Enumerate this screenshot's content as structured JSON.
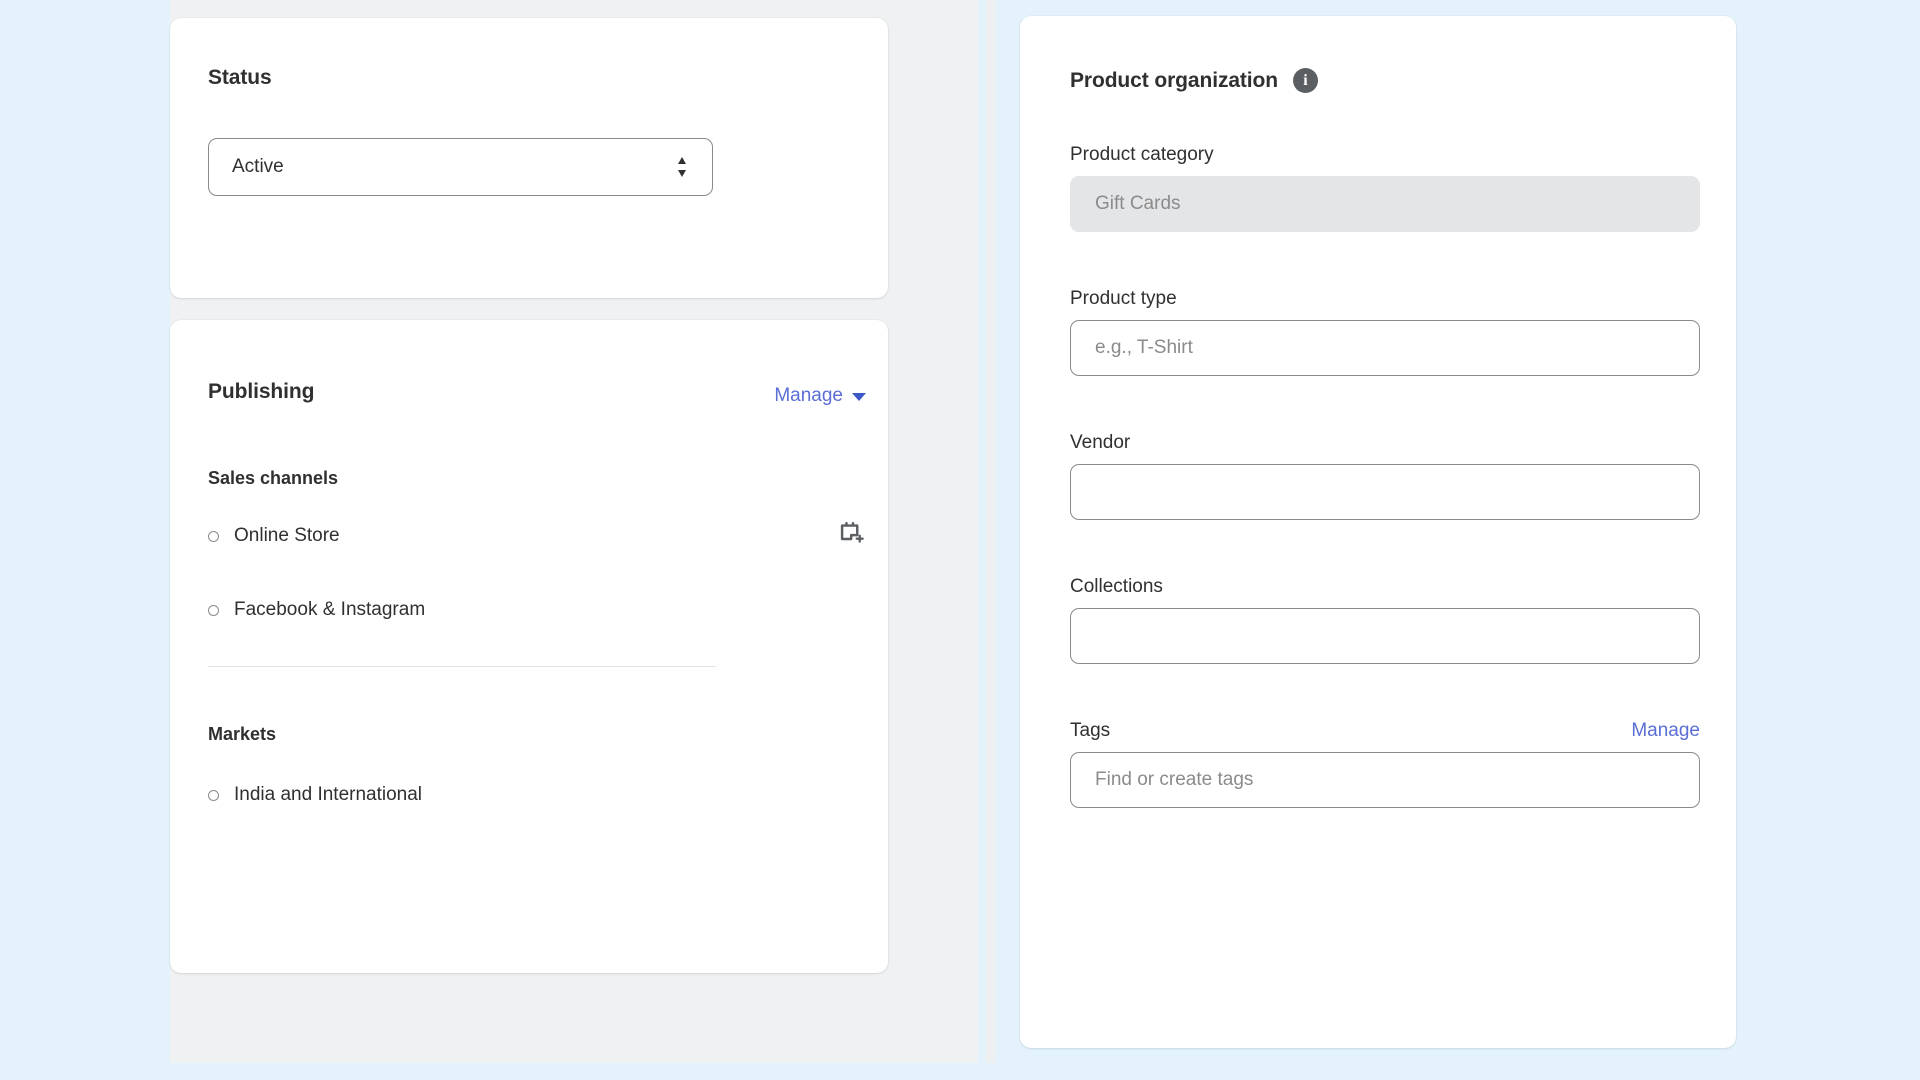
{
  "theme": {
    "page_background": "#e4f3fb",
    "panel_background": "#f0f1f2",
    "card_background": "#ffffff",
    "link_color": "#5a6ed6",
    "text_color": "#303030",
    "placeholder_color": "#8b8b8b",
    "disabled_field_background": "#e4e5e7"
  },
  "status_card": {
    "title": "Status",
    "select": {
      "value": "Active",
      "icon": "stepper-updown-icon"
    }
  },
  "publishing_card": {
    "title": "Publishing",
    "manage": {
      "label": "Manage",
      "icon": "chevron-down-icon"
    },
    "sales_channels": {
      "label": "Sales channels",
      "items": [
        {
          "name": "Online Store",
          "bullet": "circle-outline-icon",
          "action_icon": "calendar-plus-icon"
        },
        {
          "name": "Facebook & Instagram",
          "bullet": "circle-outline-icon"
        }
      ]
    },
    "markets": {
      "label": "Markets",
      "items": [
        {
          "name": "India and International",
          "bullet": "circle-outline-icon"
        }
      ]
    }
  },
  "product_organization": {
    "title": "Product organization",
    "info_icon": "info-icon",
    "info_icon_glyph": "i",
    "fields": {
      "category": {
        "label": "Product category",
        "value": "Gift Cards",
        "disabled": true
      },
      "type": {
        "label": "Product type",
        "value": "",
        "placeholder": "e.g., T-Shirt"
      },
      "vendor": {
        "label": "Vendor",
        "value": "",
        "placeholder": ""
      },
      "collections": {
        "label": "Collections",
        "value": "",
        "placeholder": ""
      },
      "tags": {
        "label": "Tags",
        "manage_label": "Manage",
        "value": "",
        "placeholder": "Find or create tags"
      }
    }
  }
}
